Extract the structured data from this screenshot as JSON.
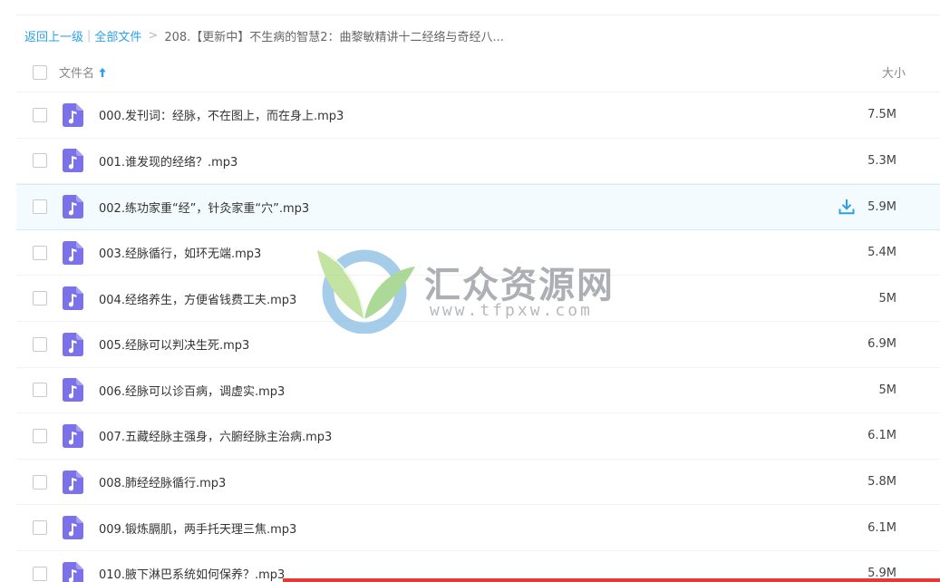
{
  "breadcrumb": {
    "back": "返回上一级",
    "separator": "|",
    "all_files": "全部文件",
    "chevron": ">",
    "current": "208.【更新中】不生病的智慧2：曲黎敏精讲十二经络与奇经八..."
  },
  "list_header": {
    "name_label": "文件名",
    "size_label": "大小",
    "sort_icon": "arrow-up-icon"
  },
  "files": [
    {
      "name": "000.发刊词：经脉，不在图上，而在身上.mp3",
      "size": "7.5M"
    },
    {
      "name": "001.谁发现的经络？.mp3",
      "size": "5.3M"
    },
    {
      "name": "002.练功家重“经”，针灸家重“穴”.mp3",
      "size": "5.9M",
      "hovered": true
    },
    {
      "name": "003.经脉循行，如环无端.mp3",
      "size": "5.4M"
    },
    {
      "name": "004.经络养生，方便省钱费工夫.mp3",
      "size": "5M"
    },
    {
      "name": "005.经脉可以判决生死.mp3",
      "size": "6.9M"
    },
    {
      "name": "006.经脉可以诊百病，调虚实.mp3",
      "size": "5M"
    },
    {
      "name": "007.五藏经脉主强身，六腑经脉主治病.mp3",
      "size": "6.1M"
    },
    {
      "name": "008.肺经经脉循行.mp3",
      "size": "5.8M"
    },
    {
      "name": "009.锻炼膈肌，两手托天理三焦.mp3",
      "size": "6.1M"
    },
    {
      "name": "010.腋下淋巴系统如何保养？.mp3",
      "size": "5.9M"
    }
  ],
  "watermark": {
    "title": "汇众资源网",
    "url": "www.tfpxw.com"
  },
  "colors": {
    "link": "#2aa0e8",
    "file_icon": "#7b72e9",
    "download": "#2aa0e8",
    "hover_row": "#f4fbff",
    "bottom_bar": "#e53935"
  }
}
